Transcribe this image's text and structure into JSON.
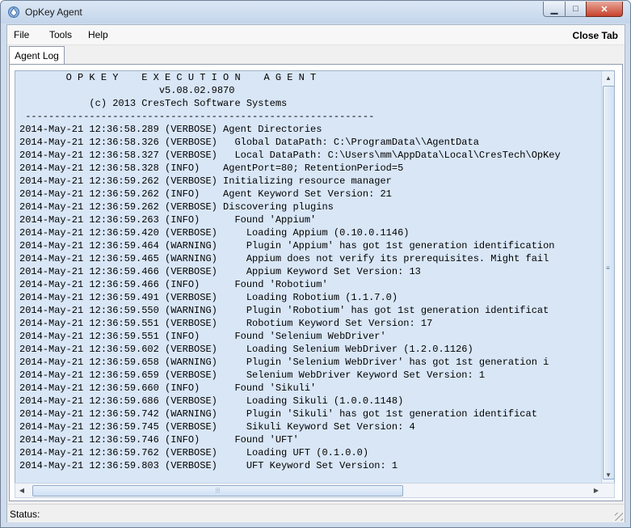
{
  "window": {
    "title": "OpKey Agent",
    "min_glyph": "▁",
    "max_glyph": "□",
    "close_glyph": "✕"
  },
  "menu": {
    "file": "File",
    "tools": "Tools",
    "help": "Help",
    "close_tab": "Close Tab"
  },
  "tab": {
    "label": "Agent Log"
  },
  "log": {
    "lines": [
      "        O P K E Y    E X E C U T I O N    A G E N T",
      "                        v5.08.02.9870",
      "            (c) 2013 CresTech Software Systems",
      " ------------------------------------------------------------",
      "2014-May-21 12:36:58.289 (VERBOSE) Agent Directories",
      "2014-May-21 12:36:58.326 (VERBOSE)   Global DataPath: C:\\ProgramData\\\\AgentData",
      "2014-May-21 12:36:58.327 (VERBOSE)   Local DataPath: C:\\Users\\mm\\AppData\\Local\\CresTech\\OpKey",
      "2014-May-21 12:36:58.328 (INFO)    AgentPort=80; RetentionPeriod=5",
      "2014-May-21 12:36:59.262 (VERBOSE) Initializing resource manager",
      "2014-May-21 12:36:59.262 (INFO)    Agent Keyword Set Version: 21",
      "2014-May-21 12:36:59.262 (VERBOSE) Discovering plugins",
      "2014-May-21 12:36:59.263 (INFO)      Found 'Appium'",
      "2014-May-21 12:36:59.420 (VERBOSE)     Loading Appium (0.10.0.1146)",
      "2014-May-21 12:36:59.464 (WARNING)     Plugin 'Appium' has got 1st generation identification",
      "2014-May-21 12:36:59.465 (WARNING)     Appium does not verify its prerequisites. Might fail",
      "2014-May-21 12:36:59.466 (VERBOSE)     Appium Keyword Set Version: 13",
      "2014-May-21 12:36:59.466 (INFO)      Found 'Robotium'",
      "2014-May-21 12:36:59.491 (VERBOSE)     Loading Robotium (1.1.7.0)",
      "2014-May-21 12:36:59.550 (WARNING)     Plugin 'Robotium' has got 1st generation identificat",
      "2014-May-21 12:36:59.551 (VERBOSE)     Robotium Keyword Set Version: 17",
      "2014-May-21 12:36:59.551 (INFO)      Found 'Selenium WebDriver'",
      "2014-May-21 12:36:59.602 (VERBOSE)     Loading Selenium WebDriver (1.2.0.1126)",
      "2014-May-21 12:36:59.658 (WARNING)     Plugin 'Selenium WebDriver' has got 1st generation i",
      "2014-May-21 12:36:59.659 (VERBOSE)     Selenium WebDriver Keyword Set Version: 1",
      "2014-May-21 12:36:59.660 (INFO)      Found 'Sikuli'",
      "2014-May-21 12:36:59.686 (VERBOSE)     Loading Sikuli (1.0.0.1148)",
      "2014-May-21 12:36:59.742 (WARNING)     Plugin 'Sikuli' has got 1st generation identificat",
      "2014-May-21 12:36:59.745 (VERBOSE)     Sikuli Keyword Set Version: 4",
      "2014-May-21 12:36:59.746 (INFO)      Found 'UFT'",
      "2014-May-21 12:36:59.762 (VERBOSE)     Loading UFT (0.1.0.0)",
      "2014-May-21 12:36:59.803 (VERBOSE)     UFT Keyword Set Version: 1"
    ]
  },
  "scroll": {
    "up": "▲",
    "down": "▼",
    "left": "◀",
    "right": "▶",
    "grip_v": "≡",
    "grip_h": "⦙⦙⦙"
  },
  "status": {
    "label": "Status:"
  },
  "colors": {
    "log_bg": "#d8e6f6",
    "title_bg": "#c4d5ea",
    "close_btn": "#c6412c"
  }
}
